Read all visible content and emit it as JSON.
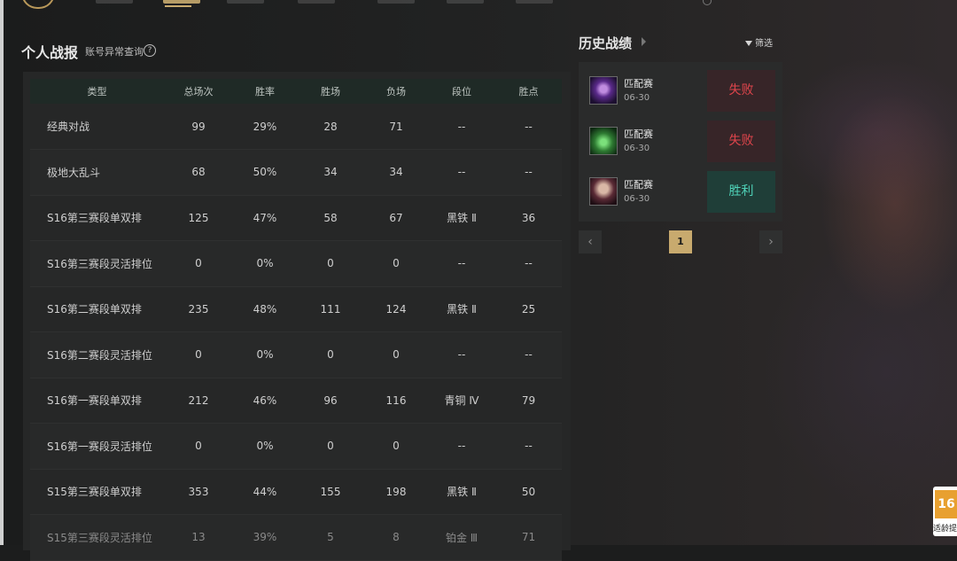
{
  "stats": {
    "title": "个人战报",
    "subtitle": "账号异常查询",
    "help_icon": "question-circle-icon",
    "columns": [
      "类型",
      "总场次",
      "胜率",
      "胜场",
      "负场",
      "段位",
      "胜点"
    ],
    "rows": [
      [
        "经典对战",
        "99",
        "29%",
        "28",
        "71",
        "--",
        "--"
      ],
      [
        "极地大乱斗",
        "68",
        "50%",
        "34",
        "34",
        "--",
        "--"
      ],
      [
        "S16第三赛段单双排",
        "125",
        "47%",
        "58",
        "67",
        "黑铁 Ⅱ",
        "36"
      ],
      [
        "S16第三赛段灵活排位",
        "0",
        "0%",
        "0",
        "0",
        "--",
        "--"
      ],
      [
        "S16第二赛段单双排",
        "235",
        "48%",
        "111",
        "124",
        "黑铁 Ⅱ",
        "25"
      ],
      [
        "S16第二赛段灵活排位",
        "0",
        "0%",
        "0",
        "0",
        "--",
        "--"
      ],
      [
        "S16第一赛段单双排",
        "212",
        "46%",
        "96",
        "116",
        "青铜 Ⅳ",
        "79"
      ],
      [
        "S16第一赛段灵活排位",
        "0",
        "0%",
        "0",
        "0",
        "--",
        "--"
      ],
      [
        "S15第三赛段单双排",
        "353",
        "44%",
        "155",
        "198",
        "黑铁 Ⅱ",
        "50"
      ],
      [
        "S15第三赛段灵活排位",
        "13",
        "39%",
        "5",
        "8",
        "铂金 Ⅲ",
        "71"
      ]
    ]
  },
  "history": {
    "title": "历史战绩",
    "filter_label": "筛选",
    "matches": [
      {
        "mode": "匹配赛",
        "date": "06-30",
        "result": "失败",
        "outcome": "lose"
      },
      {
        "mode": "匹配赛",
        "date": "06-30",
        "result": "失败",
        "outcome": "lose"
      },
      {
        "mode": "匹配赛",
        "date": "06-30",
        "result": "胜利",
        "outcome": "win"
      }
    ],
    "pagination": {
      "prev": "‹",
      "current": "1",
      "next": "›"
    }
  },
  "age_badge": {
    "number": "16",
    "text": "适龄提"
  },
  "colors": {
    "accent": "#c8aa6e",
    "lose": "#e0454c",
    "win": "#4fd3b9"
  }
}
